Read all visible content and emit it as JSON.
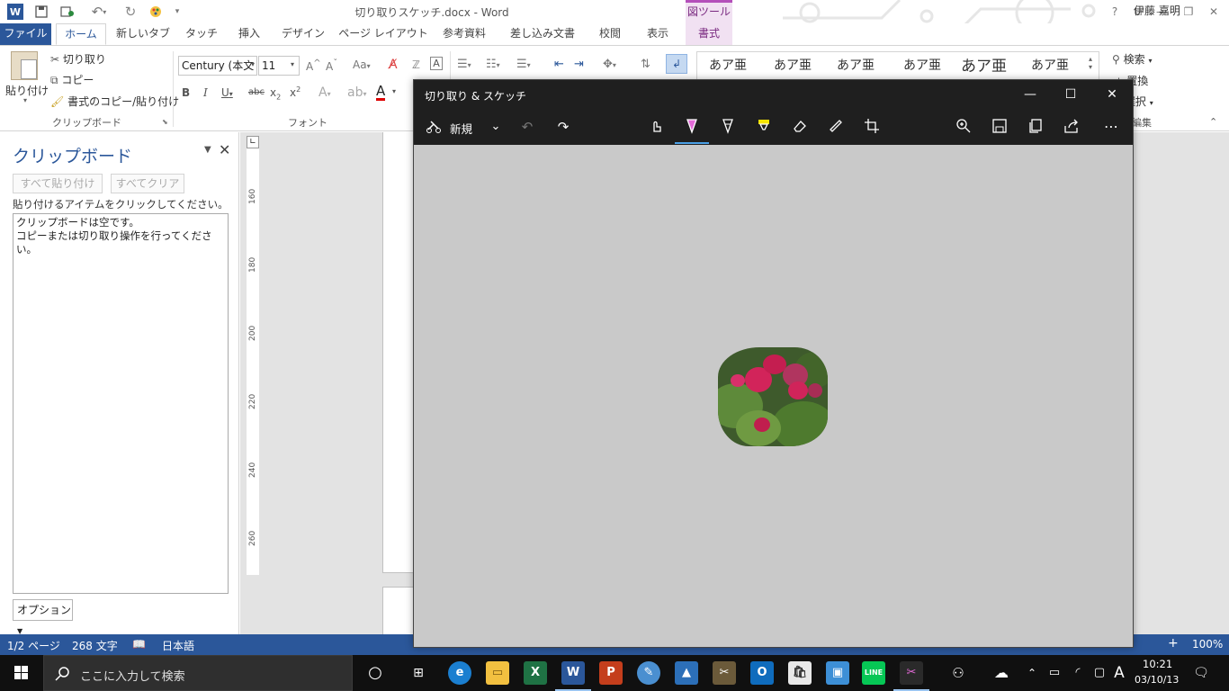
{
  "word": {
    "doc_title": "切り取りスケッチ.docx - Word",
    "context_tab_title": "図ツール",
    "user_name": "伊藤 嘉明",
    "tabs": [
      "ファイル",
      "ホーム",
      "新しいタブ",
      "タッチ",
      "挿入",
      "デザイン",
      "ページ レイアウト",
      "参考資料",
      "差し込み文書",
      "校閲",
      "表示",
      "書式"
    ],
    "clipboard_group": {
      "paste": "貼り付け",
      "cut": "切り取り",
      "copy": "コピー",
      "format_painter": "書式のコピー/貼り付け",
      "label": "クリップボード"
    },
    "font_group": {
      "font_name": "Century (本文",
      "font_size": "11",
      "label": "フォント"
    },
    "styles": [
      "あア亜",
      "あア亜",
      "あア亜",
      "あア亜",
      "あア亜",
      "あア亜"
    ],
    "editing": {
      "find": "検索",
      "replace": "置換",
      "select": "選択",
      "label": "編集"
    }
  },
  "clipboard_pane": {
    "title": "クリップボード",
    "paste_all": "すべて貼り付け",
    "clear_all": "すべてクリア",
    "instruction": "貼り付けるアイテムをクリックしてください。",
    "empty_line1": "クリップボードは空です。",
    "empty_line2": "コピーまたは切り取り操作を行ってください。",
    "options": "オプション"
  },
  "ruler": {
    "marks": [
      "160",
      "180",
      "200",
      "220",
      "240",
      "260"
    ]
  },
  "status": {
    "page": "1/2 ページ",
    "words": "268 文字",
    "language": "日本語",
    "zoom": "100%"
  },
  "snip": {
    "title": "切り取り & スケッチ",
    "new_label": "新規",
    "tools": [
      "touch-writing",
      "ballpoint-pen",
      "pencil",
      "highlighter",
      "eraser",
      "ruler",
      "crop"
    ],
    "selected_tool": "ballpoint-pen",
    "accent_colors": {
      "pen": "#e46ad8",
      "highlighter": "#f5e300"
    }
  },
  "taskbar": {
    "search_placeholder": "ここに入力して検索",
    "apps": [
      "task-view",
      "edge",
      "file-explorer",
      "excel",
      "word",
      "powerpoint",
      "paint",
      "photos",
      "photo-editor",
      "outlook",
      "store",
      "remote",
      "line",
      "snip-sketch"
    ],
    "ime": "A",
    "time": "10:21",
    "date": "03/10/13"
  },
  "colors": {
    "word_blue": "#2b579a",
    "picture_tools": "#b44fba",
    "snip_dark": "#1f1f1f",
    "canvas": "#c9c9c9"
  }
}
